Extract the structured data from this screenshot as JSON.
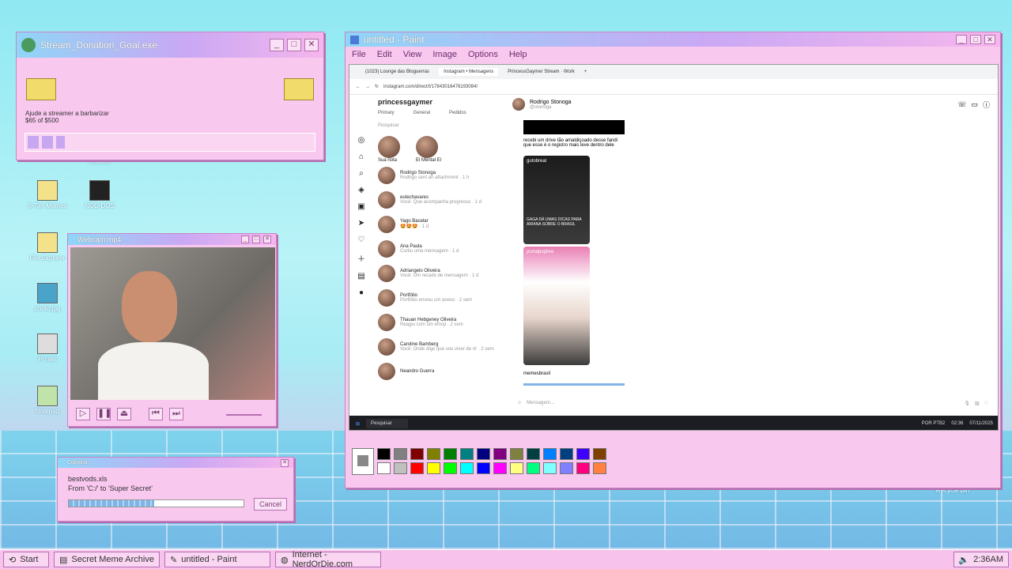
{
  "desktop": {
    "icons": [
      "5-Tier Memes",
      "NOD-DOS",
      "File Explorer",
      "photo.jpg",
      "Printer",
      "Notepad",
      "Network",
      "Recycle Bin"
    ]
  },
  "donation_window": {
    "title": "Stream_Donation_Goal.exe",
    "line1": "Ajude a streamer a barbarizar",
    "line2": "$65 of $500",
    "progress": 0.13
  },
  "webcam_window": {
    "title": "Webcam.mp4"
  },
  "copy_dialog": {
    "title": "Copying...",
    "file": "bestvods.xls",
    "path": "From 'C:/' to 'Super Secret'",
    "cancel_label": "Cancel",
    "progress": 0.49
  },
  "paint": {
    "title": "untitled - Paint",
    "menu": [
      "File",
      "Edit",
      "View",
      "Image",
      "Options",
      "Help"
    ],
    "palette": [
      "#000000",
      "#808080",
      "#800000",
      "#808000",
      "#008000",
      "#008080",
      "#000080",
      "#800080",
      "#808040",
      "#004040",
      "#0080ff",
      "#004080",
      "#4000ff",
      "#804000",
      "#ffffff",
      "#c0c0c0",
      "#ff0000",
      "#ffff00",
      "#00ff00",
      "#00ffff",
      "#0000ff",
      "#ff00ff",
      "#ffff80",
      "#00ff80",
      "#80ffff",
      "#8080ff",
      "#ff0080",
      "#ff8040"
    ]
  },
  "browser": {
    "tabs": [
      "(1023) Lounge das Bloguerras",
      "Instagram • Mensagens",
      "PrincessGaymer Stream · Work"
    ],
    "url": "instagram.com/direct/t/17843016476193084/"
  },
  "instagram": {
    "username": "princessgaymer",
    "filters": [
      "Primary",
      "General",
      "Pedidos"
    ],
    "search_placeholder": "Pesquisar",
    "notes": [
      "Sua nota",
      "El Mental El"
    ],
    "conversations": [
      {
        "name": "Rodrigo Stonoga",
        "preview": "Rodrigo sent an attachment · 1 h"
      },
      {
        "name": "eutechavares",
        "preview": "Você: Que acompanha progresso · 1 d"
      },
      {
        "name": "Yago Bacelar",
        "preview": "🤩🤩🤩 · 1 d"
      },
      {
        "name": "Ana Paula",
        "preview": "Curtiu uma mensagem · 1 d"
      },
      {
        "name": "Adriangelo Oliveira",
        "preview": "Você: Um recado de mensagem · 1 d"
      },
      {
        "name": "Portfólio",
        "preview": "Portfólio enviou um anexo · 2 sem"
      },
      {
        "name": "Thauan Hebgeney Oliveira",
        "preview": "Reagiu com um emoji · 2 sem"
      },
      {
        "name": "Caroline Bamberg",
        "preview": "Você: Onde digo que vou viver de rir · 2 sem"
      },
      {
        "name": "Neandro Guerra",
        "preview": ""
      }
    ],
    "chat_name": "Rodrigo Stonoga",
    "chat_handle": "@stonoga",
    "message_text": "recebi um drive tão amaldiçoado desse fandi que esse é o registro mais leve dentro dele",
    "post1_account": "gutobreal",
    "post1_caption": "GAGA DÁ UMAS DICAS PARA ARIANA SOBRE O BRASIL",
    "post2_account": "portalpopline",
    "post3_account": "memesbrasil",
    "message_placeholder": "Mensagem..."
  },
  "inner_taskbar": {
    "search": "Pesquisar",
    "lang": "POR PTB2",
    "time": "02:36",
    "date": "07/11/2025"
  },
  "taskbar": {
    "start_label": "Start",
    "items": [
      "Secret Meme Archive",
      "untitled - Paint",
      "Internet - NerdOrDie.com"
    ],
    "clock": "2:36AM"
  }
}
